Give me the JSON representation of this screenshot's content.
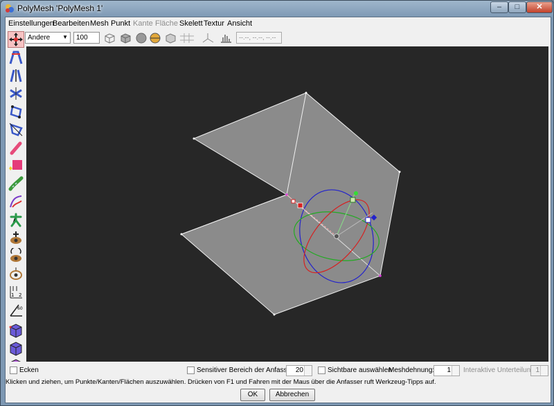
{
  "window": {
    "title": "PolyMesh 'PolyMesh 1'",
    "minimize_glyph": "–",
    "maximize_glyph": "□",
    "close_glyph": "✕"
  },
  "menubar": {
    "items": [
      {
        "label": "Einstellungen",
        "enabled": true
      },
      {
        "label": "Bearbeiten",
        "enabled": true
      },
      {
        "label": "Mesh",
        "enabled": true
      },
      {
        "label": "Punkt",
        "enabled": true
      },
      {
        "label": "Kante",
        "enabled": false
      },
      {
        "label": "Fläche",
        "enabled": false
      },
      {
        "label": "Skelett",
        "enabled": true
      },
      {
        "label": "Textur",
        "enabled": true
      },
      {
        "label": "Ansicht",
        "enabled": true
      }
    ]
  },
  "toolbar": {
    "view_select": "Andere",
    "zoom_value": "100",
    "view_buttons": [
      "wireframe-view-icon",
      "solid-view-icon",
      "smooth-view-icon",
      "textured-view-icon",
      "transparent-view-icon",
      "grid-icon",
      "axes-icon",
      "histogram-icon"
    ],
    "coord_field": "--.--, --.--, --.--"
  },
  "tools": [
    "move-points-icon",
    "scale-icon",
    "scale-vertical-icon",
    "rotate-icon",
    "skew-icon",
    "taper-icon",
    "brush-icon",
    "extrude-icon",
    "thicken-icon",
    "bevel-icon",
    "skeleton-icon",
    "move-viewpoint-icon",
    "rotate-view-icon",
    "move-view-icon",
    "measure-icon",
    "angle-icon",
    "cube-view-1-icon",
    "cube-view-2-icon",
    "cube-view-3-icon"
  ],
  "bottom": {
    "ecken_label": "Ecken",
    "sensitive_label": "Sensitiver Bereich der Anfasser",
    "sensitive_value": "20",
    "visible_select_label": "Sichtbare auswählen",
    "mesh_tension_label": "Meshdehnung:",
    "mesh_tension_value": "1",
    "interactive_subdiv_label": "Interaktive Unterteilung",
    "interactive_subdiv_value": "1",
    "help_text": "Klicken und ziehen, um Punkte/Kanten/Flächen auszuwählen. Drücken von F1 und Fahren mit der Maus über die Anfasser ruft Werkzeug-Tipps auf.",
    "ok_label": "OK",
    "cancel_label": "Abbrechen"
  },
  "colors": {
    "viewport_bg": "#272727",
    "face": "#8b8b8b",
    "x_axis": "#2222cc",
    "y_axis": "#22aa22",
    "z_axis": "#d62020"
  }
}
